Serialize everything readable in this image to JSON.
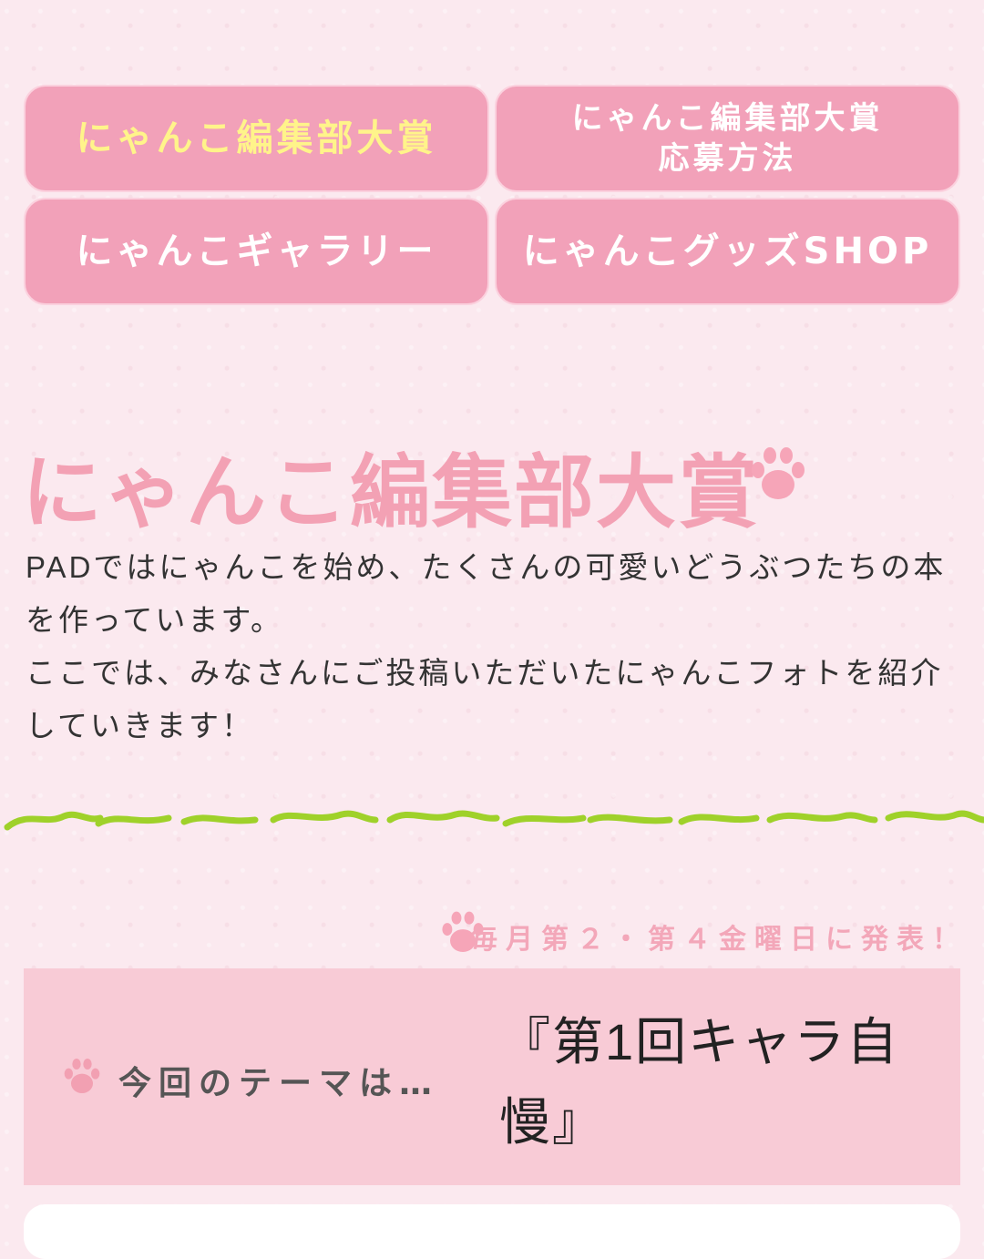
{
  "nav": {
    "items": [
      {
        "label": "にゃんこ編集部大賞",
        "active": true
      },
      {
        "label": "にゃんこ編集部大賞\n応募方法",
        "active": false
      },
      {
        "label": "にゃんこギャラリー",
        "active": false
      },
      {
        "label": "にゃんこグッズSHOP",
        "active": false
      }
    ]
  },
  "section": {
    "title": "にゃんこ編集部大賞",
    "intro": "PADではにゃんこを始め、たくさんの可愛いどうぶつたちの本を作っています。\nここでは、みなさんにご投稿いただいたにゃんこフォトを紹介していきます！"
  },
  "schedule": {
    "text": "毎月第２・第４金曜日に発表！"
  },
  "theme": {
    "label": "今回のテーマは…",
    "title": "『第1回キャラ自慢』"
  },
  "colors": {
    "accent_pink": "#f2a1b9",
    "title_pink": "#f3a1b4",
    "active_yellow": "#fff48a",
    "grass_green": "#9fd12a",
    "theme_bg": "#f8cbd6"
  },
  "icons": [
    "paw-icon",
    "grass-divider"
  ]
}
